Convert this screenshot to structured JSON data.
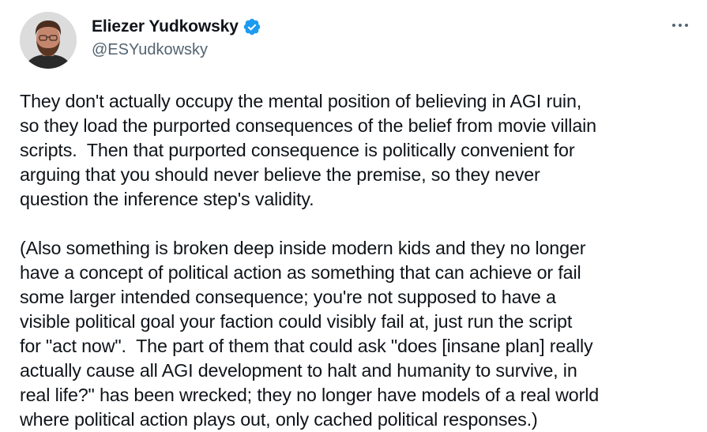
{
  "author": {
    "display_name": "Eliezer Yudkowsky",
    "handle": "@ESYudkowsky",
    "verified": true,
    "verified_icon": "verified-badge-icon",
    "verified_color": "#1d9bf0"
  },
  "menu": {
    "more_icon": "more-horizontal-icon"
  },
  "tweet": {
    "paragraph_1": "They don't actually occupy the mental position of believing in AGI ruin,\nso they load the purported consequences of the belief from movie villain\nscripts.  Then that purported consequence is politically convenient for\narguing that you should never believe the premise, so they never\nquestion the inference step's validity.",
    "paragraph_2": "(Also something is broken deep inside modern kids and they no longer\nhave a concept of political action as something that can achieve or fail\nsome larger intended consequence; you're not supposed to have a\nvisible political goal your faction could visibly fail at, just run the script\nfor \"act now\".  The part of them that could ask \"does [insane plan] really\nactually cause all AGI development to halt and humanity to survive, in\nreal life?\" has been wrecked; they no longer have models of a real world\nwhere political action plays out, only cached political responses.)"
  }
}
